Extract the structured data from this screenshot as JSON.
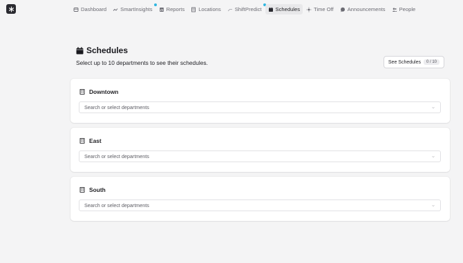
{
  "nav": {
    "items": [
      {
        "label": "Dashboard",
        "icon": "dashboard-icon"
      },
      {
        "label": "SmartInsights",
        "icon": "trend-icon",
        "badge": true
      },
      {
        "label": "Reports",
        "icon": "report-icon"
      },
      {
        "label": "Locations",
        "icon": "building-icon"
      },
      {
        "label": "ShiftPredict",
        "icon": "predict-icon",
        "badge": true
      },
      {
        "label": "Schedules",
        "icon": "calendar-icon",
        "active": true
      },
      {
        "label": "Time Off",
        "icon": "sun-icon"
      },
      {
        "label": "Announcements",
        "icon": "chat-icon"
      },
      {
        "label": "People",
        "icon": "people-icon"
      }
    ]
  },
  "header": {
    "title": "Schedules",
    "subtitle": "Select up to 10 departments to see their schedules.",
    "see_button": "See Schedules",
    "count": "0 / 10"
  },
  "locations": [
    {
      "name": "Downtown",
      "placeholder": "Search or select departments"
    },
    {
      "name": "East",
      "placeholder": "Search or select departments"
    },
    {
      "name": "South",
      "placeholder": "Search or select departments"
    }
  ],
  "colors": {
    "accent_dot": "#2fb6e0",
    "background": "#f4f4f5",
    "card": "#ffffff"
  }
}
